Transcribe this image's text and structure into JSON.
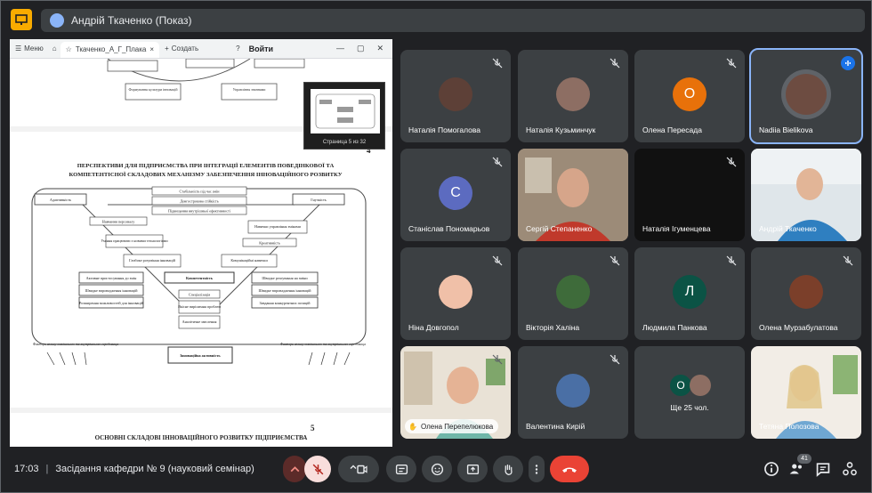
{
  "top_bar": {
    "presenter_label": "Андрій Ткаченко (Показ)"
  },
  "browser": {
    "menu_label": "Меню",
    "tab_title": "Ткаченко_А_Г_Плака",
    "new_tab_label": "Создать",
    "login_label": "Войти"
  },
  "document": {
    "thumbnail_label": "Страница 5 из 32",
    "page_number_1": "4",
    "title": "ПЕРСПЕКТИВИ ДЛЯ ПІДПРИЄМСТВА ПРИ ІНТЕГРАЦІЇ ЕЛЕМЕНТІВ ПОВЕДІНКОВОЇ ТА КОМПЕТЕНТІСНОЇ СКЛАДОВИХ МЕХАНІЗМУ ЗАБЕЗПЕЧЕННЯ ІННОВАЦІЙНОГО РОЗВИТКУ",
    "page_number_2": "5",
    "next_title": "ОСНОВНІ СКЛАДОВІ ІННОВАЦІЙНОГО РОЗВИТКУ ПІДПРИЄМСТВА",
    "diagram_boxes": {
      "top_a": "Формування культури інновацій",
      "top_b": "Управління знаннями",
      "adaptivity": "Адаптивність",
      "flexibility": "Гнучкість",
      "center_1": "Стабільність під час змін",
      "center_2": "Довгострокова стійкість",
      "center_3": "Підвищення внутрішньої ефективності",
      "left_1": "Навчання персоналу",
      "left_2": "Уміння працювати з новими технологіями",
      "left_3": "Гнучкість у сприйнятті ідей",
      "right_1": "Навички управління змінами",
      "right_2": "Креативність",
      "mid_left": "Глибоке розуміння інновацій",
      "mid_right": "Комунікаційні навички",
      "left_col_1": "Активне пристосування до змін",
      "left_col_2": "Швидке впровадження інновацій",
      "left_col_3": "Розширення можливостей для інновацій",
      "competence": "Компетентність",
      "comp_1": "Спеціалізація",
      "comp_2": "Якісне вирішення проблем",
      "comp_3": "Аналітичне мислення",
      "right_col_1": "Швидке реагування на зміни",
      "right_col_2": "Швидке впровадження інновацій",
      "right_col_3": "Завдання конкурентних позицій",
      "left_note": "Фактори впливу зовнішнього та внутрішнього середовища",
      "right_note": "Фактори впливу зовнішнього та внутрішнього середовища",
      "bottom": "Інноваційна активність"
    }
  },
  "participants": [
    {
      "name": "Наталія Помогалова"
    },
    {
      "name": "Наталія Кузьминчук"
    },
    {
      "name": "Олена Пересада",
      "initial": "О"
    },
    {
      "name": "Nadiia Bielikova"
    },
    {
      "name": "Станіслав Пономарьов",
      "initial": "С"
    },
    {
      "name": "Сергій Степаненко"
    },
    {
      "name": "Наталія Ігуменцева"
    },
    {
      "name": "Андрій Ткаченко"
    },
    {
      "name": "Ніна Довгопол"
    },
    {
      "name": "Вікторія Халіна"
    },
    {
      "name": "Людмила Панкова",
      "initial": "Л"
    },
    {
      "name": "Олена Мурзабулатова"
    },
    {
      "name": "Олена Перепелюкова"
    },
    {
      "name": "Валентина Кирій"
    },
    {
      "name": "Ще 25 чол.",
      "initial": "О"
    },
    {
      "name": "Тетяна Полозова"
    }
  ],
  "bottom_bar": {
    "time": "17:03",
    "meeting_title": "Засідання кафедри № 9 (науковий семінар)",
    "participant_count": "41"
  },
  "colors": {
    "background": "#202124",
    "tile": "#3c4043",
    "end_call": "#ea4335",
    "active_border": "#8ab4f8",
    "avatar_orange": "#e8710a",
    "avatar_blue": "#5c6bc0",
    "avatar_green": "#0b5345"
  }
}
